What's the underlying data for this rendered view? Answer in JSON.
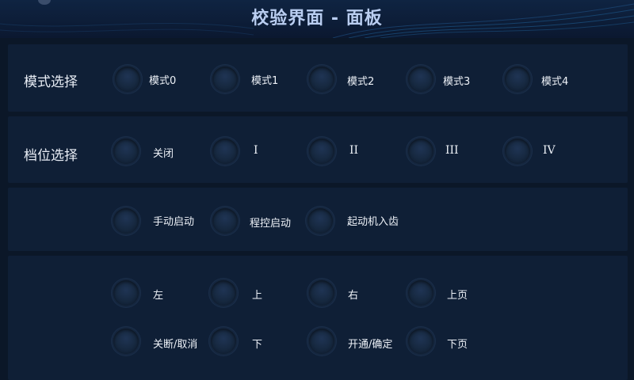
{
  "header": {
    "title": "校验界面 - 面板"
  },
  "mode": {
    "label": "模式选择",
    "options": [
      "模式0",
      "模式1",
      "模式2",
      "模式3",
      "模式4"
    ]
  },
  "gear": {
    "label": "档位选择",
    "options": [
      "关闭",
      "I",
      "II",
      "III",
      "IV"
    ]
  },
  "start": {
    "options": [
      "手动启动",
      "程控启动",
      "起动机入齿"
    ]
  },
  "nav": {
    "row1": [
      "左",
      "上",
      "右",
      "上页"
    ],
    "row2": [
      "关断/取消",
      "下",
      "开通/确定",
      "下页"
    ]
  },
  "colors": {
    "background": "#0b1728",
    "panel": "#0f1f36",
    "title": "#b9cdf0",
    "button": "#16283f"
  }
}
